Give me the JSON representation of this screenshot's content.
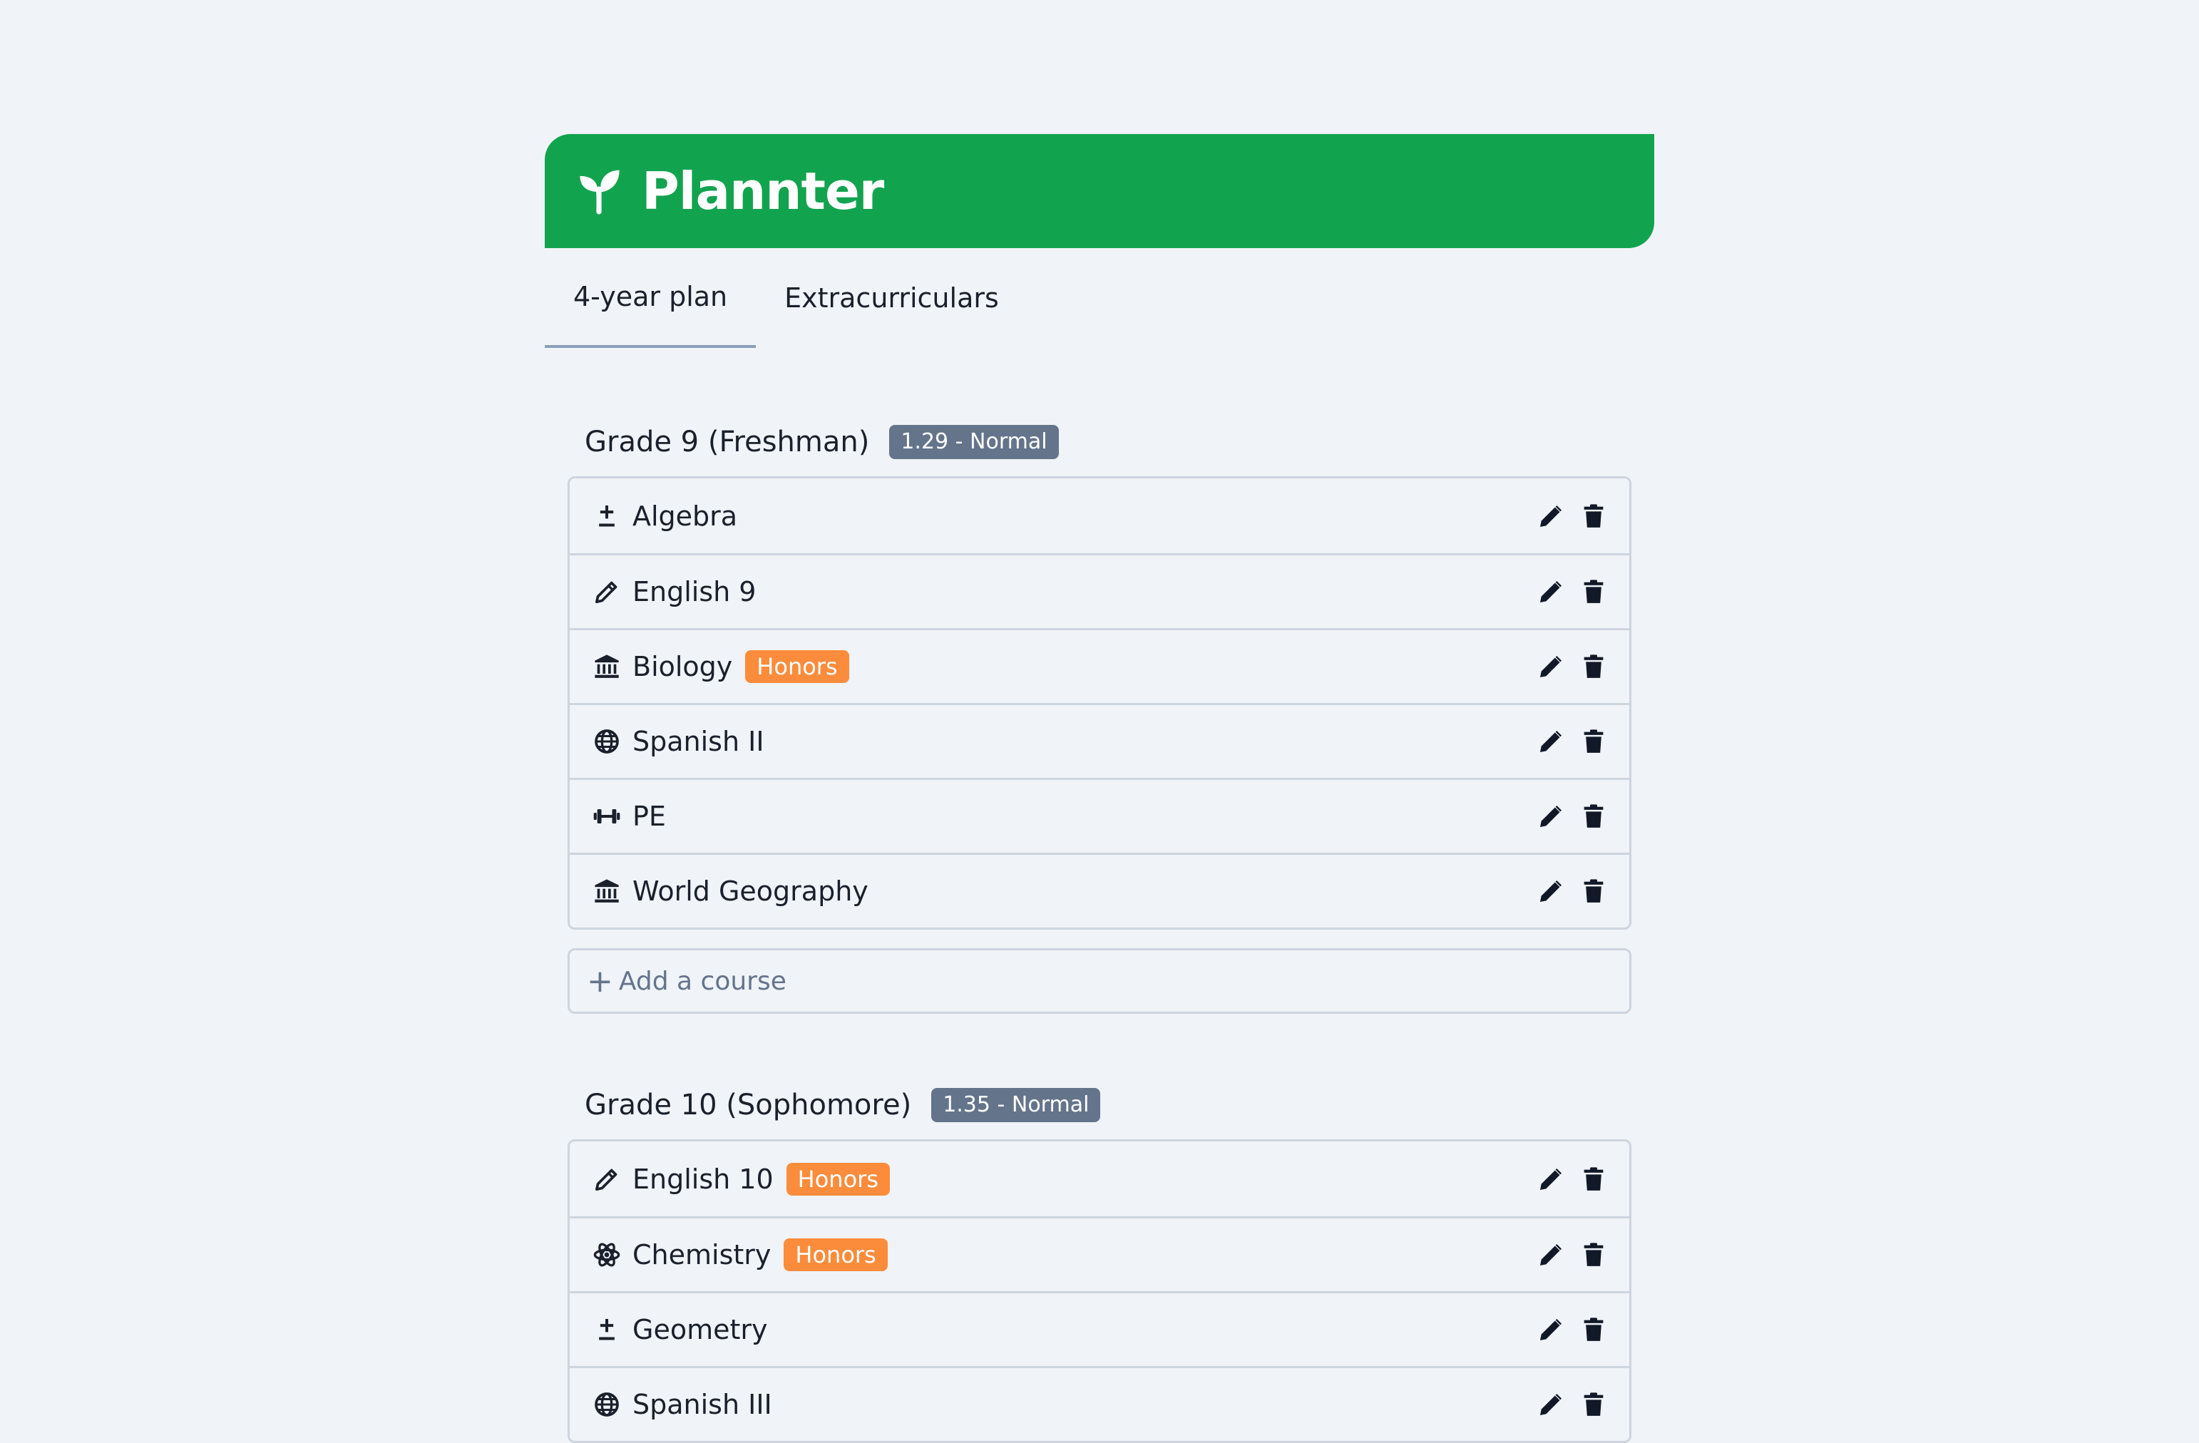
{
  "app": {
    "title": "Plannter",
    "logo_icon": "sprout-icon",
    "brand_color": "#12a34f"
  },
  "tabs": [
    {
      "label": "4-year plan",
      "active": true
    },
    {
      "label": "Extracurriculars",
      "active": false
    }
  ],
  "grades": [
    {
      "title": "Grade 9 (Freshman)",
      "badge": "1.29 - Normal",
      "courses": [
        {
          "name": "Algebra",
          "icon": "plus-minus-icon"
        },
        {
          "name": "English 9",
          "icon": "pencil-icon"
        },
        {
          "name": "Biology",
          "icon": "institution-icon",
          "tag": "Honors"
        },
        {
          "name": "Spanish II",
          "icon": "globe-icon"
        },
        {
          "name": "PE",
          "icon": "dumbbell-icon"
        },
        {
          "name": "World Geography",
          "icon": "institution-icon"
        }
      ],
      "add_label": "Add a course"
    },
    {
      "title": "Grade 10 (Sophomore)",
      "badge": "1.35 - Normal",
      "courses": [
        {
          "name": "English 10",
          "icon": "pencil-icon",
          "tag": "Honors"
        },
        {
          "name": "Chemistry",
          "icon": "atom-icon",
          "tag": "Honors"
        },
        {
          "name": "Geometry",
          "icon": "plus-minus-icon"
        },
        {
          "name": "Spanish III",
          "icon": "globe-icon"
        }
      ]
    }
  ],
  "colors": {
    "honors": "#fb8c3c",
    "badge": "#64748b",
    "background": "#f0f3f7"
  }
}
